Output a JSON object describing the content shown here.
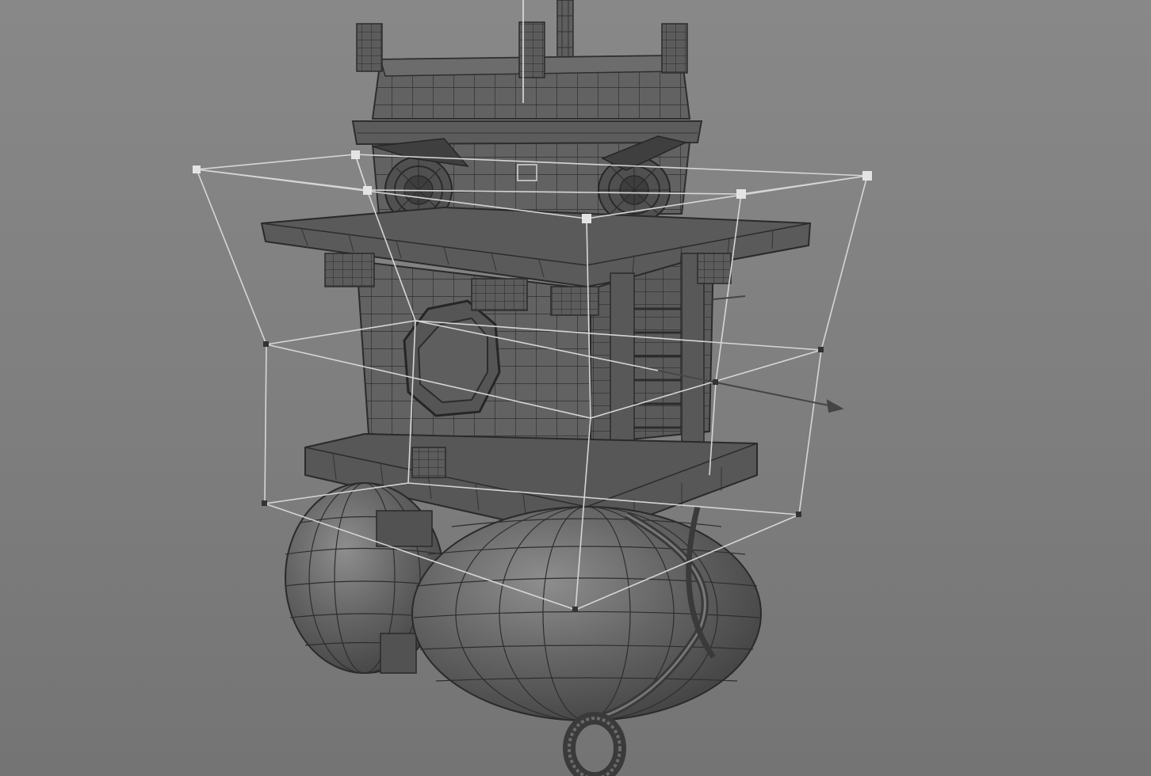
{
  "viewport": {
    "background_top": "#888888",
    "background_bottom": "#747474",
    "mesh_fill": "#616161",
    "mesh_dark": "#4a4a4a",
    "wire_color": "#2e2e2e",
    "lattice_color": "#d6d6d6",
    "control_point_color": "#e4e4e4",
    "manipulator_color": "#444444"
  },
  "scene": {
    "model": "airship-fortress-model",
    "deformer": "lattice-deformer",
    "lattice_points_visible": 12,
    "tool": "move-tool"
  }
}
